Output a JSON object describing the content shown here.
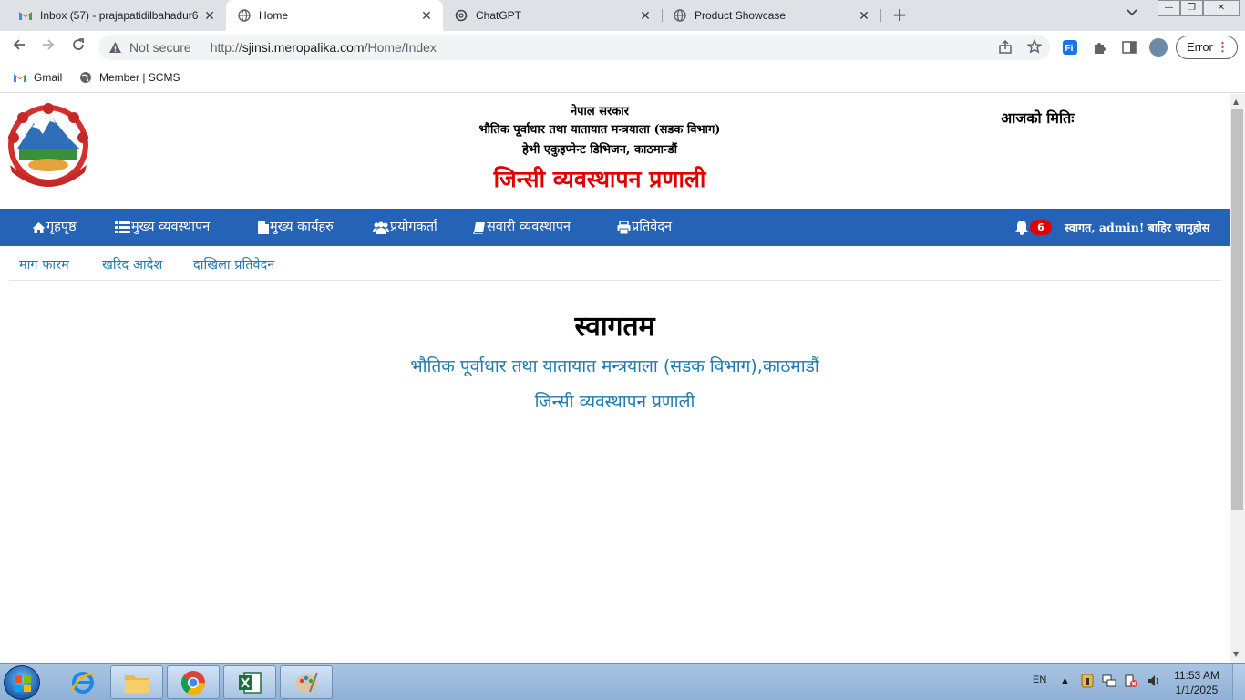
{
  "browser": {
    "tabs": [
      {
        "title": "Inbox (57) - prajapatidilbahadur6",
        "icon": "gmail-icon",
        "active": false
      },
      {
        "title": "Home",
        "icon": "globe-icon",
        "active": true
      },
      {
        "title": "ChatGPT",
        "icon": "chatgpt-icon",
        "active": false
      },
      {
        "title": "Product Showcase",
        "icon": "globe-icon",
        "active": false
      }
    ],
    "new_tab_label": "+",
    "security_label": "Not secure",
    "url_prefix": "http://",
    "url_host": "sjinsi.meropalika.com",
    "url_path": "/Home/Index",
    "error_button": "Error",
    "bookmarks": [
      {
        "label": "Gmail",
        "icon": "gmail-icon"
      },
      {
        "label": "Member | SCMS",
        "icon": "globe-icon"
      }
    ]
  },
  "header": {
    "line1": "नेपाल सरकार",
    "line2": "भौतिक पूर्वाधार तथा यातायात मन्त्रयाला (सडक विभाग)",
    "line3": "हेभी एकुइप्मेन्ट डिभिजन, काठमान्डौं",
    "title": "जिन्सी व्यवस्थापन प्रणाली",
    "date_label": "आजको मितिः"
  },
  "nav": {
    "items": [
      {
        "label": "गृहपृष्ठ",
        "icon": "home-icon"
      },
      {
        "label": "मुख्य व्यवस्थापन",
        "icon": "list-icon"
      },
      {
        "label": "मुख्य कार्यहरु",
        "icon": "file-icon"
      },
      {
        "label": "प्रयोगकर्ता",
        "icon": "users-icon"
      },
      {
        "label": "सवारी व्यवस्थापन",
        "icon": "book-icon"
      },
      {
        "label": "प्रतिवेदन",
        "icon": "print-icon"
      }
    ],
    "notification_count": "6",
    "welcome_text": "स्वागत, admin! बाहिर जानुहोस"
  },
  "subnav": {
    "items": [
      "माग फारम",
      "खरिद आदेश",
      "दाखिला प्रतिवेदन"
    ]
  },
  "main": {
    "heading": "स्वागतम",
    "subtitle1": "भौतिक पूर्वाधार तथा यातायात मन्त्रयाला (सडक विभाग),काठमाडौं",
    "subtitle2": "जिन्सी व्यवस्थापन प्रणाली"
  },
  "taskbar": {
    "language": "EN",
    "time": "11:53 AM",
    "date": "1/1/2025"
  },
  "colors": {
    "nav_bg": "#2563b7",
    "title_red": "#e00000",
    "link_blue": "#1f7ab0"
  }
}
